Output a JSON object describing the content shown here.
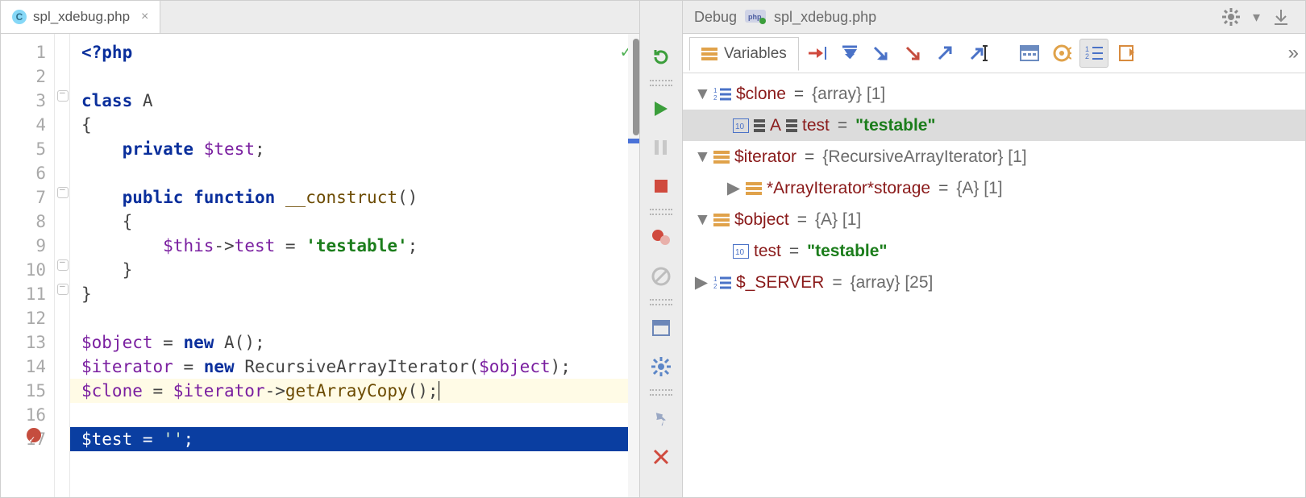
{
  "tab": {
    "filename": "spl_xdebug.php",
    "file_icon_letter": "C"
  },
  "debug_header": {
    "label": "Debug",
    "script": "spl_xdebug.php"
  },
  "gutter_lines": [
    "1",
    "2",
    "3",
    "4",
    "5",
    "6",
    "7",
    "8",
    "9",
    "10",
    "11",
    "12",
    "13",
    "14",
    "15",
    "16",
    "17"
  ],
  "code": {
    "l1": {
      "open": "<?php"
    },
    "l3": {
      "kw": "class",
      "name": "A"
    },
    "l4": "{",
    "l5": {
      "kw": "private",
      "var": "$test",
      "tail": ";"
    },
    "l7": {
      "kw1": "public",
      "kw2": "function",
      "fn": "__construct",
      "tail": "()"
    },
    "l8": "    {",
    "l9": {
      "var": "$this",
      "arrow": "->",
      "prop": "test",
      "eq": " = ",
      "str": "'testable'",
      "tail": ";"
    },
    "l10": "    }",
    "l11": "}",
    "l13": {
      "var": "$object",
      "eq": " = ",
      "kw": "new",
      "cls": " A()",
      "tail": ";"
    },
    "l14": {
      "var": "$iterator",
      "eq": " = ",
      "kw": "new",
      "cls": " RecursiveArrayIterator(",
      "arg": "$object",
      "tail": ");"
    },
    "l15": {
      "var": "$clone",
      "eq": " = ",
      "var2": "$iterator",
      "arrow": "->",
      "fn": "getArrayCopy",
      "tail": "();"
    },
    "l17": {
      "var": "$test",
      "eq": " = ",
      "str": "''",
      "tail": ";"
    }
  },
  "variables_tab_label": "Variables",
  "tree": {
    "clone": {
      "name": "$clone",
      "eq": " = ",
      "type": "{array} [1]"
    },
    "clone_item": {
      "prefix1": "A",
      "prefix2": "test",
      "eq": " = ",
      "val": "\"testable\""
    },
    "iterator": {
      "name": "$iterator",
      "eq": " = ",
      "type": "{RecursiveArrayIterator} [1]"
    },
    "storage": {
      "name": "*ArrayIterator*storage",
      "eq": " = ",
      "type": "{A} [1]"
    },
    "object": {
      "name": "$object",
      "eq": " = ",
      "type": "{A} [1]"
    },
    "obj_test": {
      "name": "test",
      "eq": " = ",
      "val": "\"testable\""
    },
    "server": {
      "name": "$_SERVER",
      "eq": " = ",
      "type": "{array} [25]"
    }
  }
}
